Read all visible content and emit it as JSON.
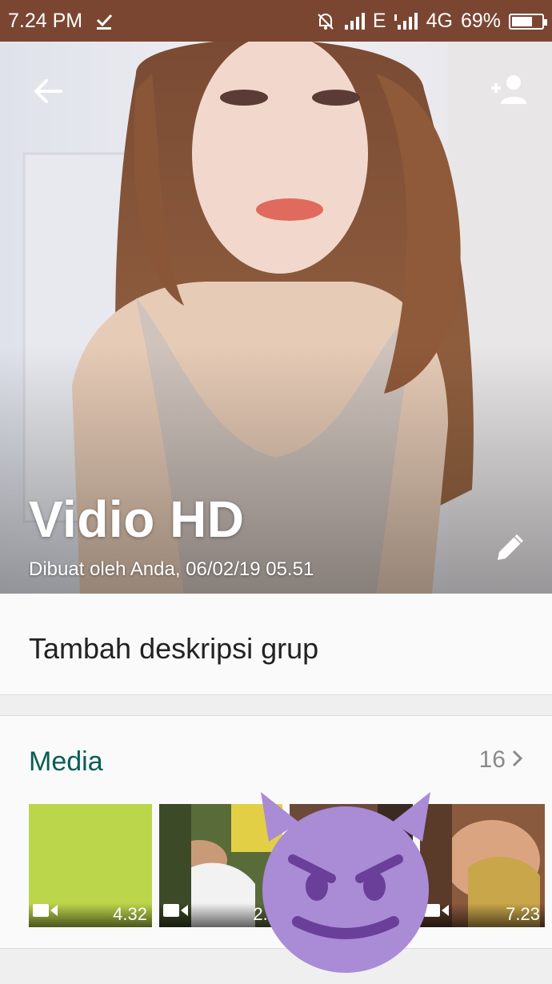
{
  "status_bar": {
    "time": "7.24 PM",
    "network_1": "E",
    "network_2": "4G",
    "battery_percent": "69%",
    "battery_level": 0.69,
    "icons": [
      "download-done-icon",
      "bell-off-icon",
      "signal-icon",
      "signal-icon",
      "battery-icon"
    ]
  },
  "header": {
    "group_name": "Vidio HD",
    "created_text": "Dibuat oleh Anda, 06/02/19 05.51",
    "icons": [
      "back-arrow-icon",
      "add-participant-icon",
      "edit-pencil-icon"
    ]
  },
  "description": {
    "placeholder": "Tambah deskripsi grup"
  },
  "media": {
    "title": "Media",
    "count": "16",
    "items": [
      {
        "duration": "4.32",
        "type": "video"
      },
      {
        "duration": "2.2",
        "type": "video"
      },
      {
        "duration": "",
        "type": "video"
      },
      {
        "duration": "7.23",
        "type": "video"
      }
    ]
  },
  "overlay": {
    "emoji": "smiling-face-with-horns-icon"
  },
  "colors": {
    "status_bar": "#7a4632",
    "accent": "#075e54",
    "emoji": "#a98bd6"
  }
}
